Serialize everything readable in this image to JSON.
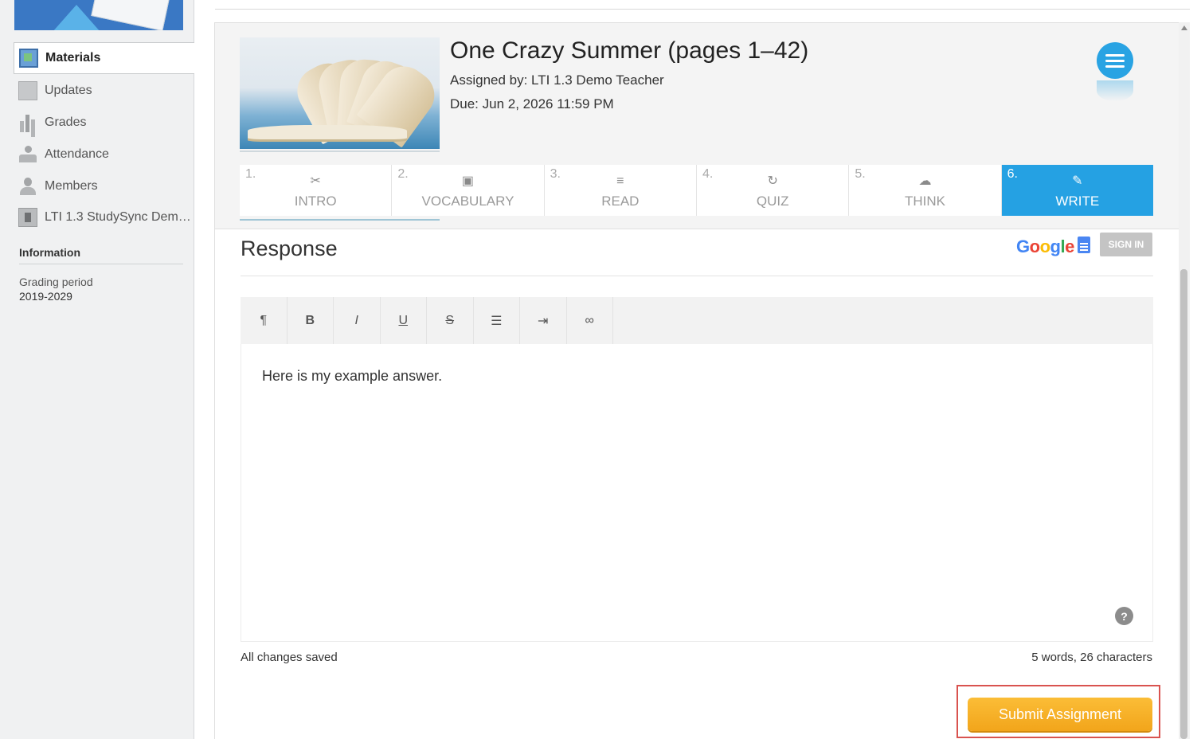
{
  "sidebar": {
    "items": [
      {
        "label": "Materials",
        "icon": "materials-icon",
        "active": true
      },
      {
        "label": "Updates",
        "icon": "updates-icon"
      },
      {
        "label": "Grades",
        "icon": "grades-icon"
      },
      {
        "label": "Attendance",
        "icon": "attendance-icon"
      },
      {
        "label": "Members",
        "icon": "members-icon"
      },
      {
        "label": "LTI 1.3 StudySync Demo...",
        "icon": "lti-app-icon"
      }
    ],
    "information_heading": "Information",
    "grading_period_label": "Grading period",
    "grading_period_value": "2019-2029"
  },
  "assignment": {
    "title": "One Crazy Summer (pages 1–42)",
    "assigned_by": "Assigned by: LTI 1.3 Demo Teacher",
    "due": "Due: Jun 2, 2026 11:59 PM"
  },
  "tabs": [
    {
      "num": "1.",
      "label": "INTRO",
      "icon": "✂"
    },
    {
      "num": "2.",
      "label": "VOCABULARY",
      "icon": "▣"
    },
    {
      "num": "3.",
      "label": "READ",
      "icon": "≡"
    },
    {
      "num": "4.",
      "label": "QUIZ",
      "icon": "↻"
    },
    {
      "num": "5.",
      "label": "THINK",
      "icon": "☁"
    },
    {
      "num": "6.",
      "label": "WRITE",
      "icon": "✎",
      "active": true
    }
  ],
  "response": {
    "title": "Response",
    "google_text": "Google",
    "sign_in": "SIGN IN",
    "toolbar": {
      "paragraph": "¶",
      "bold": "B",
      "italic": "I",
      "underline": "U",
      "strike": "S",
      "list": "☰",
      "indent": "⇥",
      "link": "∞"
    },
    "text": "Here is my example answer.",
    "help": "?",
    "status": "All changes saved",
    "count": "5 words, 26 characters"
  },
  "submit_label": "Submit Assignment",
  "colors": {
    "accent": "#25a1e3",
    "submit": "#f5ac22",
    "highlight": "#d9534f"
  }
}
